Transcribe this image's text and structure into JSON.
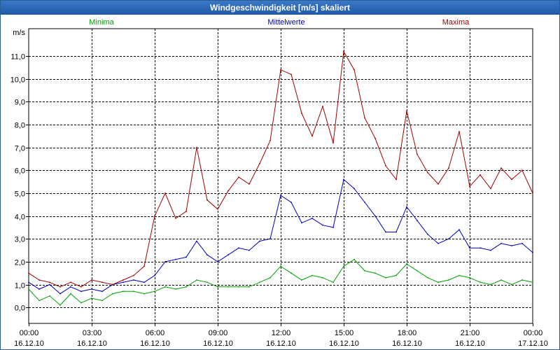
{
  "window": {
    "title": "Windgeschwindigkeit [m/s] skaliert"
  },
  "chart_data": {
    "type": "line",
    "title": "Windgeschwindigkeit [m/s] skaliert",
    "ylabel": "m/s",
    "xlabel": "",
    "ylim": [
      -0.7,
      12.2
    ],
    "xlim_hours": [
      0,
      24
    ],
    "grid": true,
    "legend_placement": "top",
    "y_ticks": [
      "0,0",
      "1,0",
      "2,0",
      "3,0",
      "4,0",
      "5,0",
      "6,0",
      "7,0",
      "8,0",
      "9,0",
      "10,0",
      "11,0"
    ],
    "x_ticks": [
      {
        "time": "00:00",
        "date": "16.12.10"
      },
      {
        "time": "03:00",
        "date": "16.12.10"
      },
      {
        "time": "06:00",
        "date": "16.12.10"
      },
      {
        "time": "09:00",
        "date": "16.12.10"
      },
      {
        "time": "12:00",
        "date": "16.12.10"
      },
      {
        "time": "15:00",
        "date": "16.12.10"
      },
      {
        "time": "18:00",
        "date": "16.12.10"
      },
      {
        "time": "21:00",
        "date": "16.12.10"
      },
      {
        "time": "00:00",
        "date": "17.12.10"
      }
    ],
    "series": [
      {
        "name": "Minima",
        "color": "#00a000",
        "x": [
          0,
          0.5,
          1,
          1.5,
          2,
          2.5,
          3,
          3.5,
          4,
          4.5,
          5,
          5.5,
          6,
          6.5,
          7,
          7.5,
          8,
          8.5,
          9,
          9.5,
          10,
          10.5,
          11,
          11.5,
          12,
          12.5,
          13,
          13.5,
          14,
          14.5,
          15,
          15.5,
          16,
          16.5,
          17,
          17.5,
          18,
          18.5,
          19,
          19.5,
          20,
          20.5,
          21,
          21.5,
          22,
          22.5,
          23,
          23.5,
          24
        ],
        "values": [
          0.8,
          0.3,
          0.5,
          0.1,
          0.6,
          0.2,
          0.4,
          0.3,
          0.6,
          0.7,
          0.7,
          0.6,
          0.7,
          0.9,
          0.8,
          0.9,
          1.2,
          1.1,
          0.9,
          0.9,
          0.9,
          0.9,
          1.1,
          1.3,
          1.8,
          1.5,
          1.2,
          1.4,
          1.3,
          1.1,
          1.8,
          2.1,
          1.6,
          1.5,
          1.3,
          1.4,
          1.9,
          1.6,
          1.3,
          1.1,
          1.2,
          1.4,
          1.3,
          1.1,
          1.0,
          1.2,
          1.0,
          1.2,
          1.1
        ]
      },
      {
        "name": "Mittelwerte",
        "color": "#0000c0",
        "x": [
          0,
          0.5,
          1,
          1.5,
          2,
          2.5,
          3,
          3.5,
          4,
          4.5,
          5,
          5.5,
          6,
          6.5,
          7,
          7.5,
          8,
          8.5,
          9,
          9.5,
          10,
          10.5,
          11,
          11.5,
          12,
          12.5,
          13,
          13.5,
          14,
          14.5,
          15,
          15.5,
          16,
          16.5,
          17,
          17.5,
          18,
          18.5,
          19,
          19.5,
          20,
          20.5,
          21,
          21.5,
          22,
          22.5,
          23,
          23.5,
          24
        ],
        "values": [
          1.1,
          0.8,
          1.0,
          0.6,
          0.9,
          0.7,
          0.8,
          0.7,
          1.0,
          1.1,
          1.2,
          1.1,
          1.4,
          2.0,
          2.1,
          2.2,
          2.9,
          2.3,
          2.0,
          2.3,
          2.6,
          2.5,
          2.9,
          3.0,
          4.9,
          4.6,
          3.7,
          3.9,
          3.6,
          3.5,
          5.6,
          5.2,
          4.6,
          4.0,
          3.3,
          3.3,
          4.4,
          3.8,
          3.2,
          2.8,
          3.0,
          3.4,
          2.6,
          2.6,
          2.5,
          2.8,
          2.7,
          2.8,
          2.4
        ]
      },
      {
        "name": "Maxima",
        "color": "#a00000",
        "x": [
          0,
          0.5,
          1,
          1.5,
          2,
          2.5,
          3,
          3.5,
          4,
          4.5,
          5,
          5.5,
          6,
          6.5,
          7,
          7.5,
          8,
          8.5,
          9,
          9.5,
          10,
          10.5,
          11,
          11.5,
          12,
          12.5,
          13,
          13.5,
          14,
          14.5,
          15,
          15.5,
          16,
          16.5,
          17,
          17.5,
          18,
          18.5,
          19,
          19.5,
          20,
          20.5,
          21,
          21.5,
          22,
          22.5,
          23,
          23.5,
          24
        ],
        "values": [
          1.5,
          1.2,
          1.1,
          0.9,
          1.1,
          0.9,
          1.2,
          1.1,
          1.0,
          1.2,
          1.4,
          1.8,
          4.0,
          5.0,
          3.9,
          4.2,
          7.0,
          4.7,
          4.3,
          5.1,
          5.7,
          5.4,
          6.3,
          7.3,
          10.4,
          10.2,
          8.5,
          7.5,
          8.8,
          7.2,
          11.2,
          10.4,
          8.3,
          7.4,
          6.2,
          5.6,
          8.6,
          6.7,
          5.9,
          5.4,
          6.1,
          7.7,
          5.3,
          5.8,
          5.2,
          6.1,
          5.6,
          6.0,
          5.0
        ]
      }
    ]
  }
}
